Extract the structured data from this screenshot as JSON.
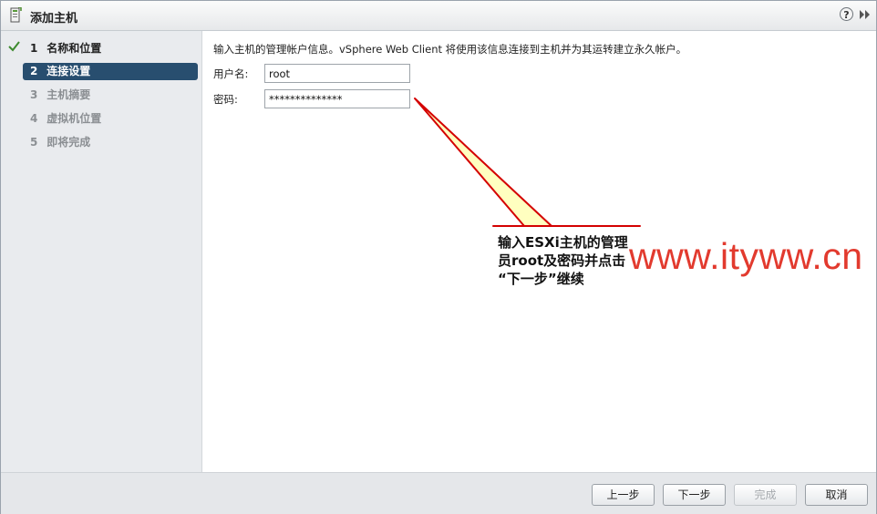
{
  "window": {
    "title": "添加主机",
    "help_label": "?"
  },
  "steps": [
    {
      "num": "1",
      "label": "名称和位置",
      "state": "done"
    },
    {
      "num": "2",
      "label": "连接设置",
      "state": "active"
    },
    {
      "num": "3",
      "label": "主机摘要",
      "state": "pending"
    },
    {
      "num": "4",
      "label": "虚拟机位置",
      "state": "pending"
    },
    {
      "num": "5",
      "label": "即将完成",
      "state": "pending"
    }
  ],
  "content": {
    "instruction": "输入主机的管理帐户信息。vSphere Web Client 将使用该信息连接到主机并为其运转建立永久帐户。",
    "username_label": "用户名:",
    "username_value": "root",
    "password_label": "密码:",
    "password_value": "**************"
  },
  "footer": {
    "back": "上一步",
    "next": "下一步",
    "finish": "完成",
    "cancel": "取消"
  },
  "annotation": {
    "callout_lines": [
      "输入ESXi主机的管理",
      "员root及密码并点击",
      "“下一步”继续"
    ],
    "watermark": "www.ityww.cn"
  },
  "colors": {
    "active_step": "#284e6f",
    "callout_fill": "#ffffc0",
    "callout_border": "#d40000",
    "watermark": "#e23a2e"
  }
}
